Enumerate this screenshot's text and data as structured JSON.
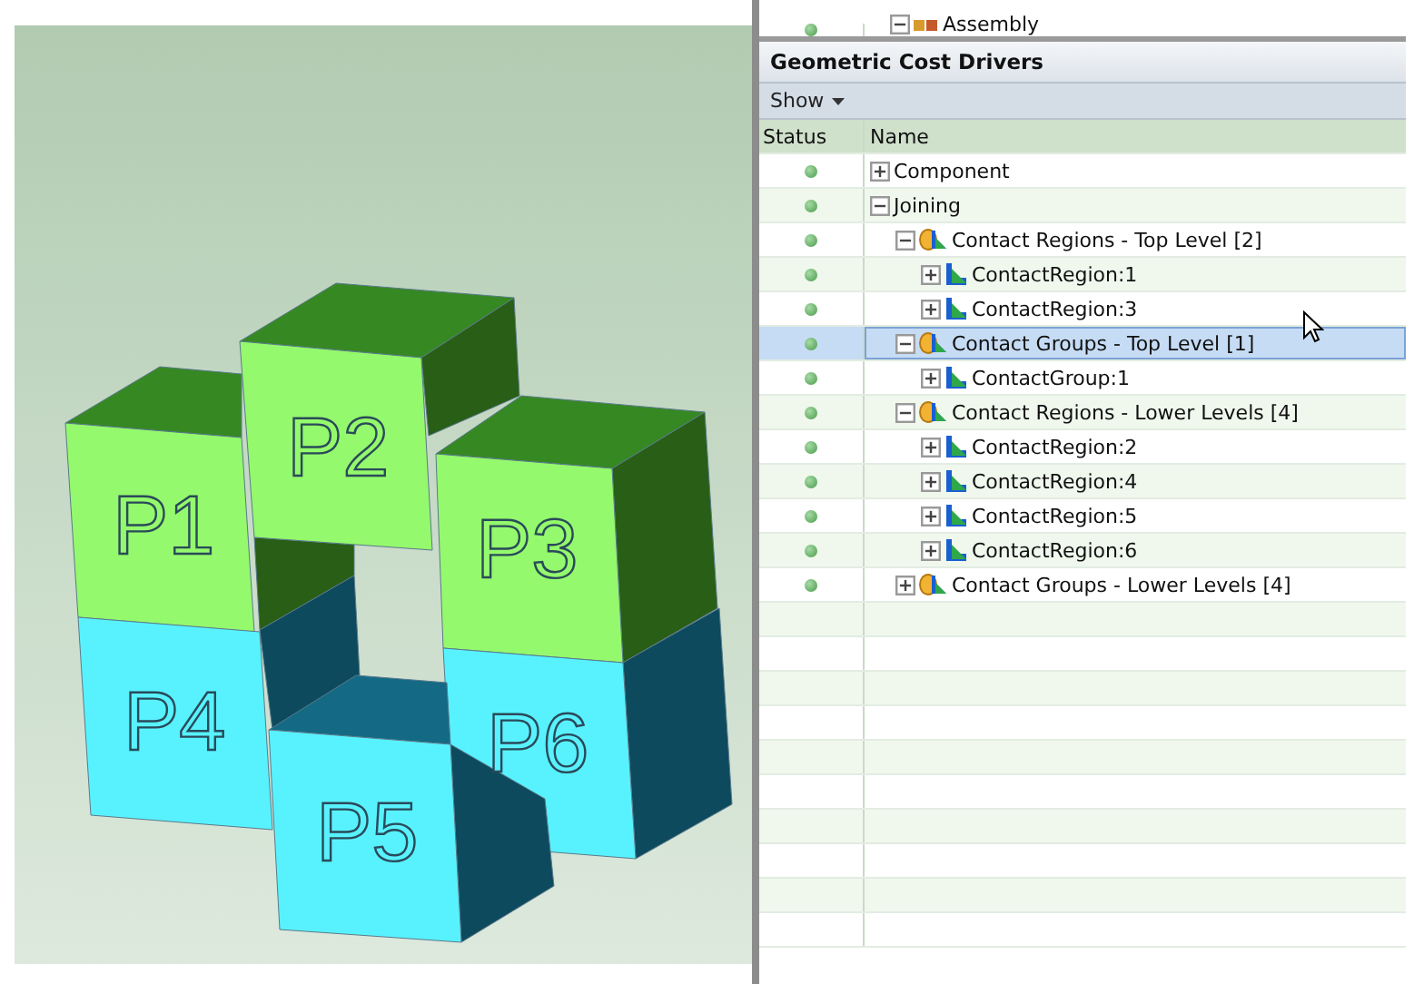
{
  "viewport": {
    "parts": [
      {
        "label": "P1",
        "kind": "upper"
      },
      {
        "label": "P2",
        "kind": "upper"
      },
      {
        "label": "P3",
        "kind": "upper"
      },
      {
        "label": "P4",
        "kind": "lower"
      },
      {
        "label": "P5",
        "kind": "lower"
      },
      {
        "label": "P6",
        "kind": "lower"
      }
    ]
  },
  "top_tree": {
    "name": "Assembly",
    "kind": "assembly",
    "expanded": true
  },
  "panel": {
    "title": "Geometric Cost Drivers",
    "show_menu": "Show",
    "columns": [
      "Status",
      "Name"
    ],
    "items": [
      {
        "name": "Component",
        "expanded": false,
        "selected": false
      },
      {
        "name": "Joining",
        "expanded": true,
        "selected": false,
        "children": [
          {
            "name": "Contact Regions - Top Level [2]",
            "kind": "group",
            "expanded": true,
            "selected": false,
            "children": [
              {
                "name": "ContactRegion:1",
                "kind": "region",
                "expanded": false,
                "selected": false
              },
              {
                "name": "ContactRegion:3",
                "kind": "region",
                "expanded": false,
                "selected": false
              }
            ]
          },
          {
            "name": "Contact Groups - Top Level [1]",
            "kind": "group",
            "expanded": true,
            "selected": true,
            "children": [
              {
                "name": "ContactGroup:1",
                "kind": "region",
                "expanded": false,
                "selected": false
              }
            ]
          },
          {
            "name": "Contact Regions - Lower Levels [4]",
            "kind": "group",
            "expanded": true,
            "selected": false,
            "children": [
              {
                "name": "ContactRegion:2",
                "kind": "region",
                "expanded": false,
                "selected": false
              },
              {
                "name": "ContactRegion:4",
                "kind": "region",
                "expanded": false,
                "selected": false
              },
              {
                "name": "ContactRegion:5",
                "kind": "region",
                "expanded": false,
                "selected": false
              },
              {
                "name": "ContactRegion:6",
                "kind": "region",
                "expanded": false,
                "selected": false
              }
            ]
          },
          {
            "name": "Contact Groups - Lower Levels [4]",
            "kind": "group",
            "expanded": false,
            "selected": false
          }
        ]
      }
    ]
  }
}
